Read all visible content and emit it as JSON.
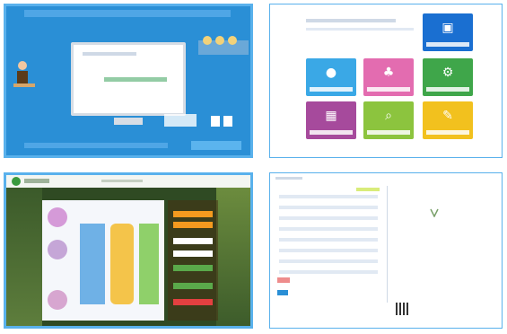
{
  "panel_infographic": {
    "bg": "#2a8fd6",
    "title": "",
    "footer": ""
  },
  "panel_dashboard": {
    "tiles": [
      {
        "color": "#1a6fd1",
        "icon": "building-icon"
      },
      {
        "color": "#3aa8e6",
        "icon": "microphone-icon"
      },
      {
        "color": "#e36cb0",
        "icon": "tree-icon"
      },
      {
        "color": "#3fa64a",
        "icon": "gears-icon"
      },
      {
        "color": "#a64a9c",
        "icon": "grid-icon"
      },
      {
        "color": "#8cc43e",
        "icon": "search-icon"
      },
      {
        "color": "#f2c11e",
        "icon": "pencil-icon"
      }
    ]
  },
  "panel_login": {
    "bg": "#2f4a23",
    "buttons": [
      {
        "color": "#f49a1f"
      },
      {
        "color": "#5aa94a"
      },
      {
        "color": "#e34040"
      }
    ]
  },
  "panel_list": {
    "accent": "#2a8fd6"
  }
}
